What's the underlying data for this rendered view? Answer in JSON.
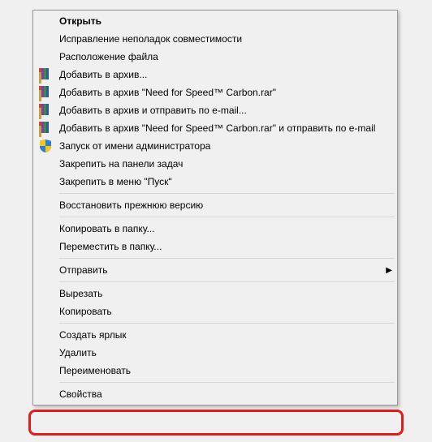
{
  "menu": {
    "items": [
      {
        "label": "Открыть",
        "bold": true,
        "icon": null
      },
      {
        "label": "Исправление неполадок совместимости",
        "icon": null
      },
      {
        "label": "Расположение файла",
        "icon": null
      },
      {
        "label": "Добавить в архив...",
        "icon": "rar"
      },
      {
        "label": "Добавить в архив \"Need for Speed™ Carbon.rar\"",
        "icon": "rar"
      },
      {
        "label": "Добавить в архив и отправить по e-mail...",
        "icon": "rar"
      },
      {
        "label": "Добавить в архив \"Need for Speed™ Carbon.rar\" и отправить по e-mail",
        "icon": "rar"
      },
      {
        "label": "Запуск от имени администратора",
        "icon": "shield"
      },
      {
        "label": "Закрепить на панели задач",
        "icon": null
      },
      {
        "label": "Закрепить в меню \"Пуск\"",
        "icon": null
      },
      {
        "separator": true
      },
      {
        "label": "Восстановить прежнюю версию",
        "icon": null
      },
      {
        "separator": true
      },
      {
        "label": "Копировать в папку...",
        "icon": null
      },
      {
        "label": "Переместить в папку...",
        "icon": null
      },
      {
        "separator": true
      },
      {
        "label": "Отправить",
        "icon": null,
        "submenu": true
      },
      {
        "separator": true
      },
      {
        "label": "Вырезать",
        "icon": null
      },
      {
        "label": "Копировать",
        "icon": null
      },
      {
        "separator": true
      },
      {
        "label": "Создать ярлык",
        "icon": null
      },
      {
        "label": "Удалить",
        "icon": null
      },
      {
        "label": "Переименовать",
        "icon": null
      },
      {
        "separator": true
      },
      {
        "label": "Свойства",
        "icon": null
      }
    ]
  }
}
